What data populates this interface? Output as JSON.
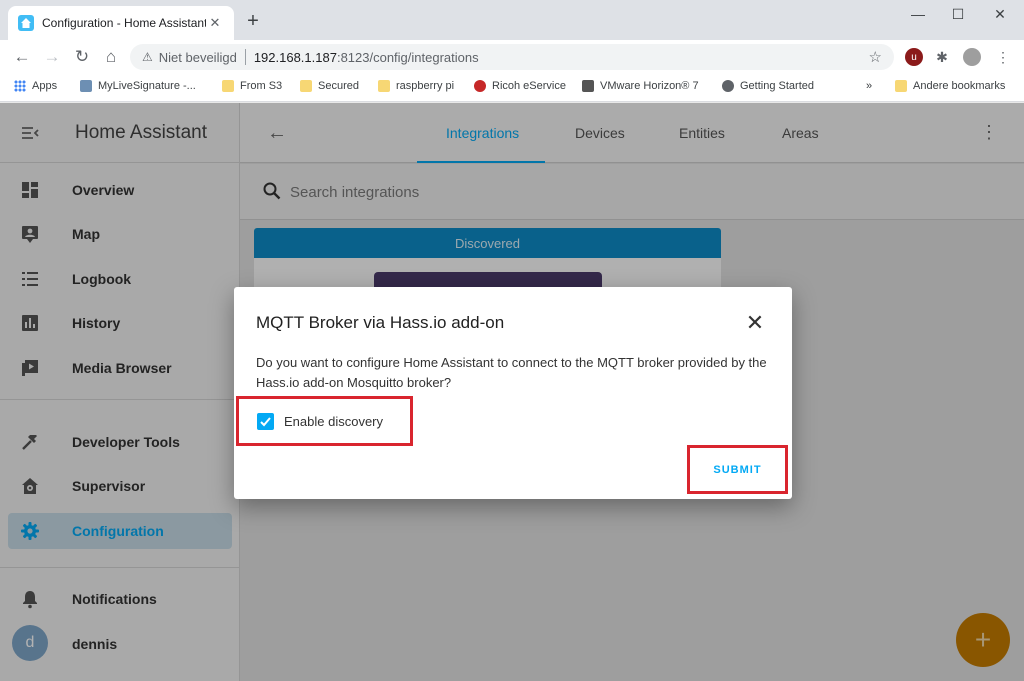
{
  "browser": {
    "tab_title": "Configuration - Home Assistant",
    "address": {
      "security_label": "Niet beveiligd",
      "host": "192.168.1.187",
      "path": ":8123/config/integrations"
    },
    "bookmarks": [
      {
        "label": "Apps"
      },
      {
        "label": "MyLiveSignature -..."
      },
      {
        "label": "From S3"
      },
      {
        "label": "Secured"
      },
      {
        "label": "raspberry pi"
      },
      {
        "label": "Ricoh eService"
      },
      {
        "label": "VMware Horizon® 7"
      },
      {
        "label": "Getting Started"
      }
    ],
    "bookmarks_overflow": "»",
    "other_bookmarks": "Andere bookmarks"
  },
  "sidebar": {
    "title": "Home Assistant",
    "items": [
      {
        "label": "Overview",
        "icon": "dashboard-icon"
      },
      {
        "label": "Map",
        "icon": "map-icon"
      },
      {
        "label": "Logbook",
        "icon": "list-icon"
      },
      {
        "label": "History",
        "icon": "chart-icon"
      },
      {
        "label": "Media Browser",
        "icon": "play-box-icon"
      },
      {
        "label": "Developer Tools",
        "icon": "hammer-icon"
      },
      {
        "label": "Supervisor",
        "icon": "home-gear-icon"
      },
      {
        "label": "Configuration",
        "icon": "gear-icon"
      },
      {
        "label": "Notifications",
        "icon": "bell-icon"
      }
    ],
    "user": {
      "initial": "d",
      "name": "dennis"
    }
  },
  "header": {
    "tabs": [
      {
        "label": "Integrations"
      },
      {
        "label": "Devices"
      },
      {
        "label": "Entities"
      },
      {
        "label": "Areas"
      }
    ]
  },
  "search": {
    "placeholder": "Search integrations"
  },
  "card": {
    "header": "Discovered"
  },
  "fab": {
    "label": "+"
  },
  "dialog": {
    "title": "MQTT Broker via Hass.io add-on",
    "body": "Do you want to configure Home Assistant to connect to the MQTT broker provided by the Hass.io add-on Mosquitto broker?",
    "checkbox_label": "Enable discovery",
    "checkbox_checked": true,
    "submit_label": "SUBMIT"
  },
  "colors": {
    "accent": "#03a9f4",
    "highlight_box": "#d9252e",
    "fab": "#c47b00"
  }
}
